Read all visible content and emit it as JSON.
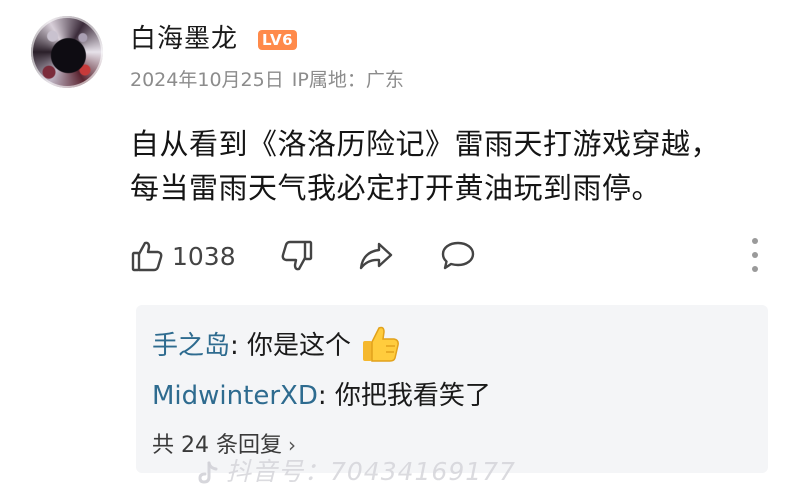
{
  "comment": {
    "username": "白海墨龙",
    "level_badge": "LV6",
    "date": "2024年10月25日",
    "ip_location": "IP属地：广东",
    "content_lines": [
      "自从看到《洛洛历险记》雷雨天打游戏穿越，",
      "每当雷雨天气我必定打开黄油玩到雨停。"
    ],
    "like_count": "1038"
  },
  "replies": {
    "items": [
      {
        "author": "手之岛",
        "separator": ": ",
        "text": "你是这个"
      },
      {
        "author": "MidwinterXD",
        "separator": ": ",
        "text": "你把我看笑了"
      }
    ],
    "more_label": "共 24 条回复",
    "more_chevron": "›"
  },
  "watermark": "抖音号：70434169177",
  "colors": {
    "badge": "#ff8a4a",
    "reply_author": "#2e6b8f",
    "reply_background": "#f4f5f7",
    "meta_text": "#8c8c8c"
  },
  "icons": [
    "avatar",
    "like-icon",
    "dislike-icon",
    "share-icon",
    "comment-icon",
    "more-icon",
    "thumbs-up-emoji",
    "douyin-logo-icon"
  ]
}
